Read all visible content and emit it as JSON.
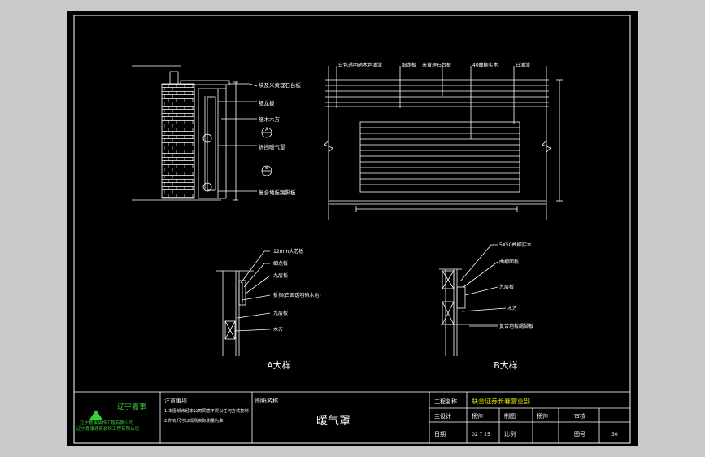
{
  "colors": {
    "line": "#ffffff",
    "accent": "#ff3030",
    "green": "#39d139",
    "yellow": "#e0e000",
    "background": "#000000"
  },
  "section_view": {
    "labels": [
      "块及米黄理石台板",
      "细龙板",
      "细木木方",
      "折挡暖气罩",
      "复合地板踢脚板"
    ],
    "markers": [
      "A",
      "B"
    ]
  },
  "elevation": {
    "labels": [
      "白色透明硝木色油漆",
      "细龙板",
      "米黄理石台板",
      "40曲柳实木",
      "白油漆"
    ]
  },
  "detail_a": {
    "labels": [
      "12mm大芯板",
      "细龙板",
      "九层板",
      "折挡(白面透明硝木色)",
      "九层板",
      "木方"
    ],
    "caption": "A大样"
  },
  "detail_b": {
    "labels": [
      "5X50曲柳实木",
      "曲柳面板",
      "九层板",
      "木方",
      "复合地板踢脚板"
    ],
    "caption": "B大样"
  },
  "title_block": {
    "company_name": "辽宁嘉事",
    "company_line1": "辽宁嘉事装饰工程有限公司",
    "company_line2": "辽宁嘉事建筑装饰工程有限公司",
    "notes_title": "注意事项",
    "note_1": "1.本图纸未经本公司同意不得以任何方式复制",
    "note_2": "2.所有尺寸以现场实际测量为准",
    "drawing_name_label": "图纸名称",
    "drawing_name": "暖气罩",
    "project_label": "工程名称",
    "project_name": "联合证券长春营业部",
    "designer_label": "主设计",
    "designer_value": "杨帅",
    "drafter_label": "制图",
    "drafter_value": "杨帅",
    "checker_label": "审核",
    "date_label": "日期",
    "date_value": "02 7 25",
    "scale_label": "比例",
    "sheet_no_label": "图号",
    "sheet_no_value": "30"
  }
}
